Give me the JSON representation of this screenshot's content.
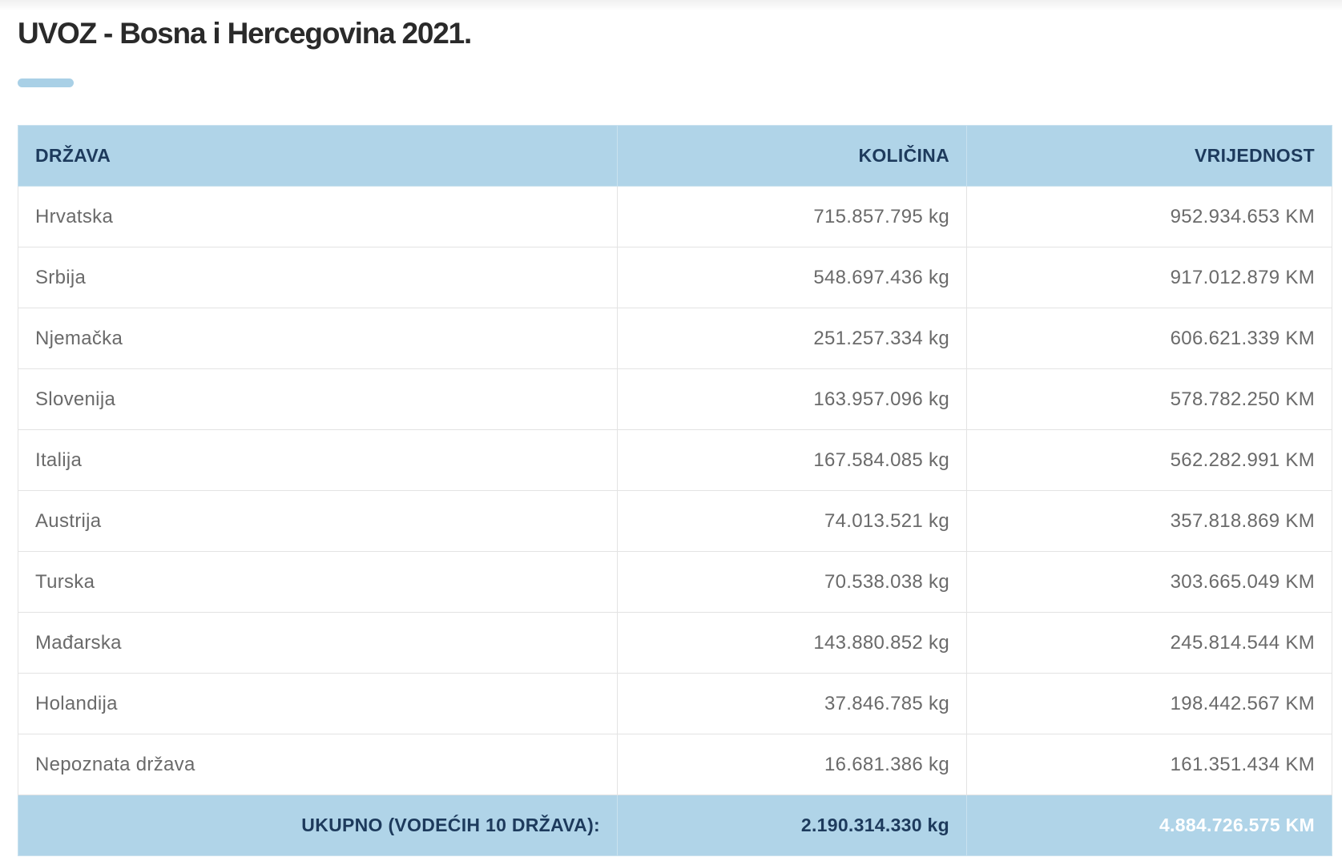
{
  "page": {
    "title": "UVOZ - Bosna i Hercegovina 2021."
  },
  "colors": {
    "header_bg": "#b0d4e8",
    "header_text": "#1d3a5c",
    "accent_bar": "#a9d0e6",
    "body_text": "#6a6a6a"
  },
  "table": {
    "headers": {
      "country": "DRŽAVA",
      "quantity": "KOLIČINA",
      "value": "VRIJEDNOST"
    },
    "rows": [
      {
        "country": "Hrvatska",
        "quantity": "715.857.795 kg",
        "value": "952.934.653 KM"
      },
      {
        "country": "Srbija",
        "quantity": "548.697.436 kg",
        "value": "917.012.879 KM"
      },
      {
        "country": "Njemačka",
        "quantity": "251.257.334 kg",
        "value": "606.621.339 KM"
      },
      {
        "country": "Slovenija",
        "quantity": "163.957.096 kg",
        "value": "578.782.250 KM"
      },
      {
        "country": "Italija",
        "quantity": "167.584.085 kg",
        "value": "562.282.991 KM"
      },
      {
        "country": "Austrija",
        "quantity": "74.013.521 kg",
        "value": "357.818.869 KM"
      },
      {
        "country": "Turska",
        "quantity": "70.538.038 kg",
        "value": "303.665.049 KM"
      },
      {
        "country": "Mađarska",
        "quantity": "143.880.852 kg",
        "value": "245.814.544 KM"
      },
      {
        "country": "Holandija",
        "quantity": "37.846.785 kg",
        "value": "198.442.567 KM"
      },
      {
        "country": "Nepoznata država",
        "quantity": "16.681.386 kg",
        "value": "161.351.434 KM"
      }
    ],
    "footer": {
      "label": "UKUPNO (VODEĆIH 10 DRŽAVA):",
      "quantity": "2.190.314.330 kg",
      "value": "4.884.726.575 KM"
    }
  }
}
